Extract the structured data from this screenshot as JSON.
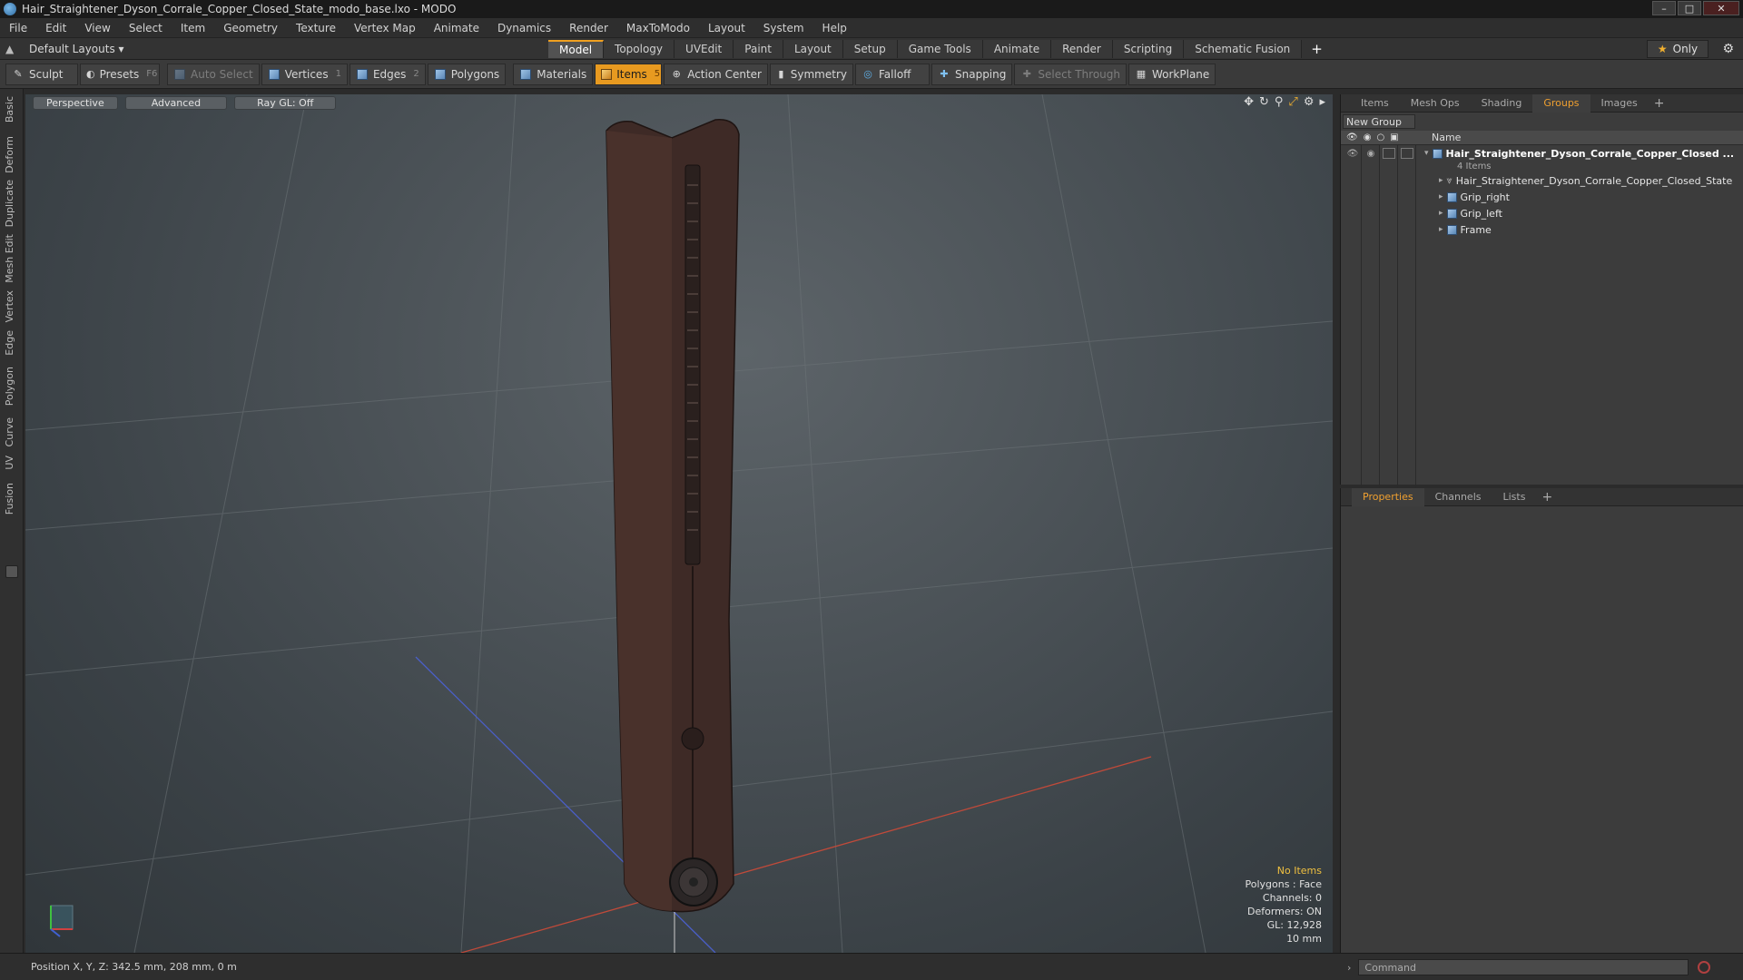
{
  "window": {
    "title": "Hair_Straightener_Dyson_Corrale_Copper_Closed_State_modo_base.lxo - MODO"
  },
  "menu": [
    "File",
    "Edit",
    "View",
    "Select",
    "Item",
    "Geometry",
    "Texture",
    "Vertex Map",
    "Animate",
    "Dynamics",
    "Render",
    "MaxToModo",
    "Layout",
    "System",
    "Help"
  ],
  "layout": {
    "selector": "Default Layouts ▾",
    "tabs": [
      "Model",
      "Topology",
      "UVEdit",
      "Paint",
      "Layout",
      "Setup",
      "Game Tools",
      "Animate",
      "Render",
      "Scripting",
      "Schematic Fusion"
    ],
    "active_tab": "Model",
    "add_tab": "+",
    "only_label": "Only"
  },
  "toolbar": {
    "sculpt": "Sculpt",
    "presets": "Presets",
    "presets_key": "F6",
    "auto_select": "Auto Select",
    "vertices": "Vertices",
    "vertices_num": "1",
    "edges": "Edges",
    "edges_num": "2",
    "polygons": "Polygons",
    "materials": "Materials",
    "items": "Items",
    "items_num": "5",
    "action_center": "Action Center",
    "symmetry": "Symmetry",
    "falloff": "Falloff",
    "snapping": "Snapping",
    "select_through": "Select Through",
    "workplane": "WorkPlane"
  },
  "left_tabs": [
    "Basic",
    "Deform",
    "Duplicate",
    "Mesh Edit",
    "Vertex",
    "Edge",
    "Polygon",
    "Curve",
    "UV",
    "Fusion"
  ],
  "viewport": {
    "perspective": "Perspective",
    "advanced": "Advanced",
    "raygl": "Ray GL: Off",
    "info": {
      "no_items": "No Items",
      "polygons": "Polygons : Face",
      "channels": "Channels: 0",
      "deformers": "Deformers: ON",
      "gl": "GL: 12,928",
      "scale": "10 mm"
    }
  },
  "scene_panel": {
    "tabs": [
      "Items",
      "Mesh Ops",
      "Shading",
      "Groups",
      "Images"
    ],
    "active_tab": "Groups",
    "add": "+",
    "new_group": "New Group",
    "name_header": "Name",
    "group_name": "Hair_Straightener_Dyson_Corrale_Copper_Closed ...",
    "group_count": "4 Items",
    "children": [
      "Hair_Straightener_Dyson_Corrale_Copper_Closed_State",
      "Grip_right",
      "Grip_left",
      "Frame"
    ]
  },
  "properties_panel": {
    "tabs": [
      "Properties",
      "Channels",
      "Lists"
    ],
    "active_tab": "Properties",
    "add": "+"
  },
  "status": {
    "position": "Position X, Y, Z:  342.5 mm, 208 mm, 0 m",
    "command_placeholder": "Command"
  }
}
